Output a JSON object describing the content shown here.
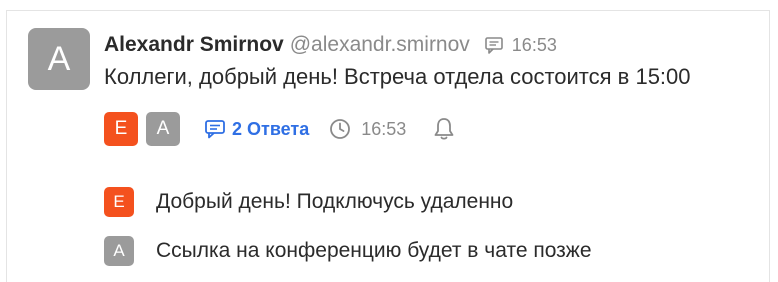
{
  "message": {
    "avatar_letter": "A",
    "author": "Alexandr Smirnov",
    "handle": "@alexandr.smirnov",
    "time": "16:53",
    "text": "Коллеги, добрый день! Встреча отдела состоится в 15:00"
  },
  "thread": {
    "participants": [
      {
        "letter": "E",
        "color": "#f4511e"
      },
      {
        "letter": "A",
        "color": "#9b9b9b"
      }
    ],
    "replies_label": "2 Ответа",
    "last_reply_time": "16:53"
  },
  "replies": [
    {
      "avatar_letter": "E",
      "color": "#f4511e",
      "text": "Добрый день! Подключусь удаленно"
    },
    {
      "avatar_letter": "A",
      "color": "#9b9b9b",
      "text": "Ссылка на конференцию будет в чате позже"
    }
  ],
  "colors": {
    "accent": "#2f6fe4",
    "text": "#2b2b2b",
    "muted": "#8a8a8a"
  }
}
